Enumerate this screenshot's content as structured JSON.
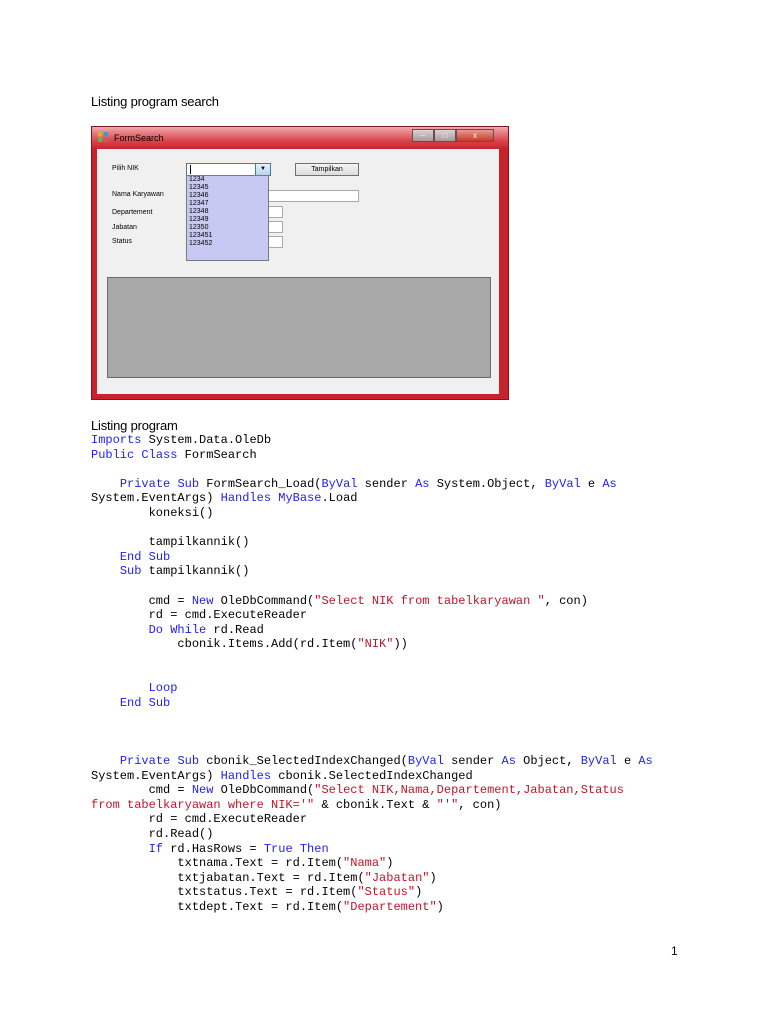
{
  "title1": "Listing  program search",
  "title2": "Listing program",
  "window": {
    "title": "FormSearch",
    "close_glyph": "x",
    "min_glyph": "–",
    "max_glyph": "□",
    "labels": [
      "Pilih NIK",
      "Nama Karyawan",
      "Departement",
      "Jabatan",
      "Status"
    ],
    "button": "Tampilkan",
    "combo_arrow": "▼",
    "options": [
      "1234",
      "12345",
      "12346",
      "12347",
      "12348",
      "12349",
      "12350",
      "123451",
      "123452"
    ]
  },
  "code": [
    "Imports System.Data.OleDb",
    "Public Class FormSearch",
    "",
    "    Private Sub FormSearch_Load(ByVal sender As System.Object, ByVal e As",
    "System.EventArgs) Handles MyBase.Load",
    "        koneksi()",
    "",
    "        tampilkannik()",
    "    End Sub",
    "    Sub tampilkannik()",
    "",
    "        cmd = New OleDbCommand(\"Select NIK from tabelkaryawan \", con)",
    "        rd = cmd.ExecuteReader",
    "        Do While rd.Read",
    "            cbonik.Items.Add(rd.Item(\"NIK\"))",
    "",
    "",
    "        Loop",
    "    End Sub",
    "",
    "",
    "",
    "    Private Sub cbonik_SelectedIndexChanged(ByVal sender As Object, ByVal e As",
    "System.EventArgs) Handles cbonik.SelectedIndexChanged",
    "        cmd = New OleDbCommand(\"Select NIK,Nama,Departement,Jabatan,Status",
    "from tabelkaryawan where NIK='\" & cbonik.Text & \"'\", con)",
    "        rd = cmd.ExecuteReader",
    "        rd.Read()",
    "        If rd.HasRows = True Then",
    "            txtnama.Text = rd.Item(\"Nama\")",
    "            txtjabatan.Text = rd.Item(\"Jabatan\")",
    "            txtstatus.Text = rd.Item(\"Status\")",
    "            txtdept.Text = rd.Item(\"Departement\")"
  ],
  "page_number": "1"
}
